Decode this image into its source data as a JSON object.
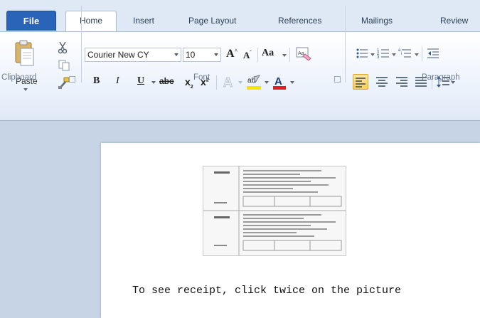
{
  "tabs": {
    "file": "File",
    "home": "Home",
    "insert": "Insert",
    "page_layout": "Page Layout",
    "references": "References",
    "mailings": "Mailings",
    "review": "Review"
  },
  "clipboard": {
    "paste_label": "Paste",
    "group_label": "Clipboard"
  },
  "font": {
    "font_name": "Courier New CY",
    "font_size": "10",
    "grow_glyph": "A",
    "shrink_glyph": "A",
    "change_case_label": "Aa",
    "bold_glyph": "B",
    "italic_glyph": "I",
    "underline_glyph": "U",
    "strike_glyph": "abc",
    "subscript_glyph": "x",
    "superscript_glyph": "x",
    "font_color_glyph": "A",
    "highlight_glyph": "ab",
    "group_label": "Font",
    "highlight_color": "#f6e300",
    "font_color": "#e0211d"
  },
  "paragraph": {
    "group_label": "Paragraph"
  },
  "document": {
    "caption": "To see receipt, click twice on the picture"
  }
}
